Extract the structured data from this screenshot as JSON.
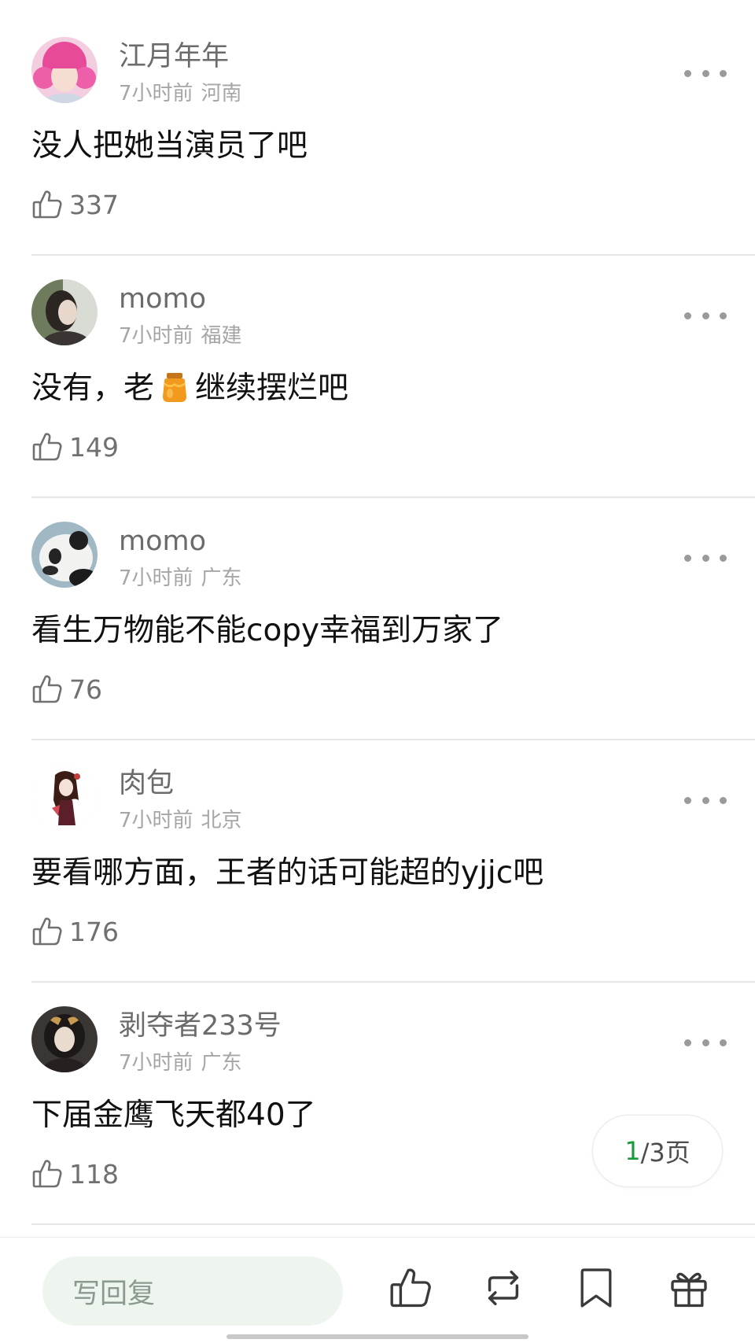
{
  "comments": [
    {
      "username": "江月年年",
      "time": "7小时前",
      "location": "河南",
      "text": "没人把她当演员了吧",
      "likes": "337",
      "avatar_icon": "pink-hair-girl-avatar"
    },
    {
      "username": "momo",
      "time": "7小时前",
      "location": "福建",
      "text_before": "没有，老",
      "emoji": "honey-jar-emoji",
      "text_after": "继续摆烂吧",
      "likes": "149",
      "avatar_icon": "girl-photo-avatar"
    },
    {
      "username": "momo",
      "time": "7小时前",
      "location": "广东",
      "text": "看生万物能不能copy幸福到万家了",
      "likes": "76",
      "avatar_icon": "panda-avatar"
    },
    {
      "username": "肉包",
      "time": "7小时前",
      "location": "北京",
      "text": "要看哪方面，王者的话可能超的yjjc吧",
      "likes": "176",
      "avatar_icon": "anime-girl-avatar"
    },
    {
      "username": "剥夺者233号",
      "time": "7小时前",
      "location": "广东",
      "text": "下届金鹰飞天都40了",
      "likes": "118",
      "avatar_icon": "dark-portrait-avatar"
    }
  ],
  "pager": {
    "current": "1",
    "total": "/3页"
  },
  "bottom_bar": {
    "reply_placeholder": "写回复",
    "icons": [
      "thumbs-up-icon",
      "repost-icon",
      "bookmark-icon",
      "gift-icon"
    ]
  },
  "colors": {
    "accent_green": "#1a9a3a",
    "reply_bg": "#eef5ef",
    "divider": "#e6e6e6"
  }
}
